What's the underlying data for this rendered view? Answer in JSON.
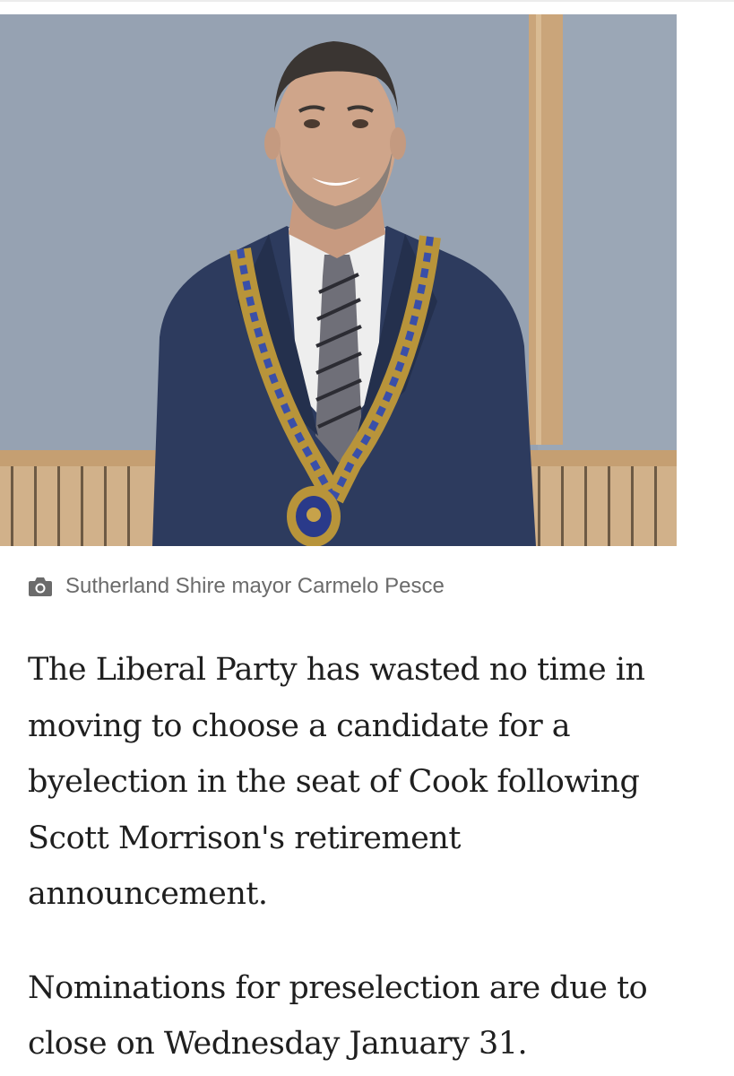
{
  "photo": {
    "alt_description": "",
    "icons": {
      "caption_icon": "camera-icon"
    }
  },
  "caption": {
    "text": "Sutherland Shire mayor Carmelo Pesce"
  },
  "article": {
    "paragraphs": [
      "The Liberal Party has wasted no time in moving to choose a candidate for a byelection in the seat of Cook following Scott Morrison's retirement announcement.",
      "Nominations for preselection are due to close on Wednesday January 31."
    ]
  },
  "colors": {
    "caption_text": "#6b6b6b",
    "body_text": "#1f1f1f",
    "wall_blue": "#9aa6b5",
    "wood": "#c9a57a",
    "suit": "#2c3a5c"
  }
}
